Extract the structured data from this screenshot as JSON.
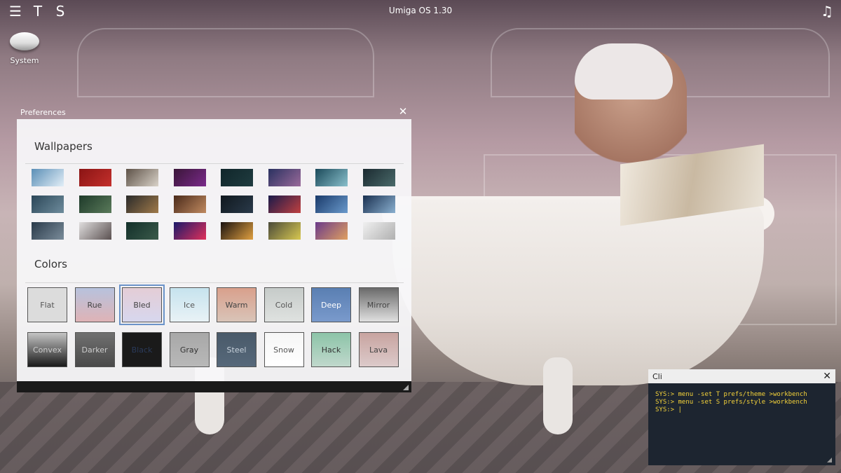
{
  "menubar": {
    "menu_icon": "hamburger-menu-icon",
    "t_label": "T",
    "s_label": "S",
    "title": "Umiga OS 1.30",
    "music_icon": "music-note-icon"
  },
  "desktop": {
    "icons": [
      {
        "label": "System",
        "icon": "drive-icon"
      }
    ]
  },
  "preferences": {
    "title": "Preferences",
    "close_glyph": "✕",
    "wallpapers_title": "Wallpapers",
    "colors_title": "Colors",
    "wallpapers": [
      {
        "c1": "#5b8fb6",
        "c2": "#e2eef7"
      },
      {
        "c1": "#8a1414",
        "c2": "#c4302c"
      },
      {
        "c1": "#5e5248",
        "c2": "#d9d2c8"
      },
      {
        "c1": "#3a1638",
        "c2": "#7a2a8a"
      },
      {
        "c1": "#10262a",
        "c2": "#203c40"
      },
      {
        "c1": "#2a3160",
        "c2": "#9a6a9a"
      },
      {
        "c1": "#1b4a5a",
        "c2": "#8ac0cc"
      },
      {
        "c1": "#1b2a30",
        "c2": "#4a6a6a"
      },
      {
        "c1": "#2b4658",
        "c2": "#6e8c9c"
      },
      {
        "c1": "#1e3a2a",
        "c2": "#5a7a5a"
      },
      {
        "c1": "#2a2a2a",
        "c2": "#a07a4a"
      },
      {
        "c1": "#4a2a1a",
        "c2": "#c08a60"
      },
      {
        "c1": "#10181e",
        "c2": "#2a3a4a"
      },
      {
        "c1": "#1a1a4a",
        "c2": "#c04040"
      },
      {
        "c1": "#1a3a6a",
        "c2": "#6a9acc"
      },
      {
        "c1": "#1a3050",
        "c2": "#8ab0d0"
      },
      {
        "c1": "#2a3a4a",
        "c2": "#7a8c9a"
      },
      {
        "c1": "#e0dede",
        "c2": "#5a5050"
      },
      {
        "c1": "#13302a",
        "c2": "#3a5a4a"
      },
      {
        "c1": "#1a1a6a",
        "c2": "#e0305a"
      },
      {
        "c1": "#1a1210",
        "c2": "#e0a040"
      },
      {
        "c1": "#4a4a3a",
        "c2": "#d8c850"
      },
      {
        "c1": "#6a3a8a",
        "c2": "#e0a060"
      },
      {
        "c1": "#f0f0f0",
        "c2": "#b0b0b0"
      }
    ],
    "colors": [
      {
        "label": "Flat",
        "c1": "#dcdcdc",
        "c2": "#dcdcdc",
        "text": "#555555"
      },
      {
        "label": "Rue",
        "c1": "#b7c2dd",
        "c2": "#dfb3b6",
        "text": "#444444"
      },
      {
        "label": "Bled",
        "c1": "#e4cdd6",
        "c2": "#d7d7ee",
        "text": "#444444",
        "selected": true
      },
      {
        "label": "Ice",
        "c1": "#c6e3ee",
        "c2": "#e9f2f6",
        "text": "#555555"
      },
      {
        "label": "Warm",
        "c1": "#d9a08c",
        "c2": "#d9c4b8",
        "text": "#444444"
      },
      {
        "label": "Cold",
        "c1": "#c6cbc9",
        "c2": "#dfe2e0",
        "text": "#555555"
      },
      {
        "label": "Deep",
        "c1": "#5a7fb2",
        "c2": "#7a9acc",
        "text": "#ffffff"
      },
      {
        "label": "Mirror",
        "c1": "#6a6a6a",
        "c2": "#e0e0e0",
        "text": "#444444"
      },
      {
        "label": "Convex",
        "c1": "#c4c4c4",
        "c2": "#1a1a1a",
        "text": "#cccccc"
      },
      {
        "label": "Darker",
        "c1": "#707070",
        "c2": "#4a4a4a",
        "text": "#cccccc"
      },
      {
        "label": "Black",
        "c1": "#1a1a1a",
        "c2": "#1a1a1a",
        "text": "#2a3a5a"
      },
      {
        "label": "Gray",
        "c1": "#a8a8a8",
        "c2": "#b8b8b8",
        "text": "#333333"
      },
      {
        "label": "Steel",
        "c1": "#4a5a6a",
        "c2": "#56687a",
        "text": "#c8d2dc"
      },
      {
        "label": "Snow",
        "c1": "#f6f6f6",
        "c2": "#ffffff",
        "text": "#555555"
      },
      {
        "label": "Hack",
        "c1": "#8cc4a8",
        "c2": "#c0d8cc",
        "text": "#333333"
      },
      {
        "label": "Lava",
        "c1": "#c8a4a0",
        "c2": "#dccaca",
        "text": "#444444"
      }
    ]
  },
  "cli": {
    "title": "Cli",
    "close_glyph": "✕",
    "lines": [
      "SYS:> menu -set T prefs/theme >workbench",
      "SYS:> menu -set S prefs/style >workbench",
      "SYS:> |"
    ]
  }
}
